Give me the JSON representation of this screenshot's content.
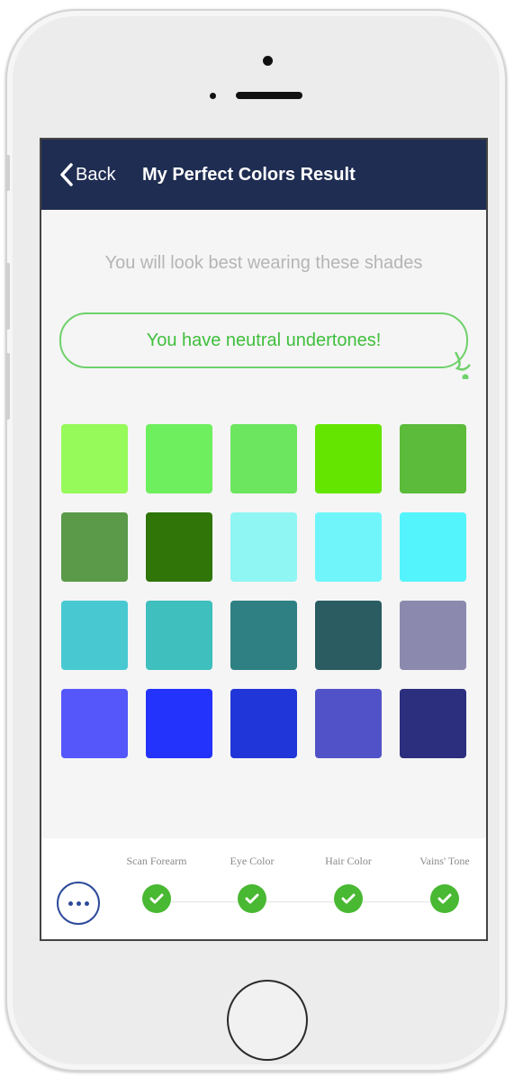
{
  "navbar": {
    "back_label": "Back",
    "title": "My Perfect Colors Result"
  },
  "main": {
    "subtitle": "You will look best wearing these shades",
    "undertone_message": "You have neutral undertones!"
  },
  "swatches": [
    [
      "#96fa5a",
      "#6eef5e",
      "#6ce65f",
      "#64e500",
      "#5cbb3a"
    ],
    [
      "#5a9a48",
      "#2f7508",
      "#8ff6f4",
      "#70f6fa",
      "#54f4fc"
    ],
    [
      "#48c9d2",
      "#3fbfbd",
      "#2f8082",
      "#2a5c62",
      "#8b89ae"
    ],
    [
      "#5557fb",
      "#2433fb",
      "#2136d8",
      "#5252c8",
      "#2c2f7e"
    ]
  ],
  "colors": {
    "navbar_bg": "#1f2d52",
    "accent_green": "#3fbf3c",
    "check_green": "#49b832",
    "more_blue": "#2d4a9a"
  },
  "progress": {
    "more_icon": "ellipsis-icon",
    "steps": [
      {
        "label": "Scan Forearm",
        "done": true,
        "icon": "check-icon"
      },
      {
        "label": "Eye Color",
        "done": true,
        "icon": "check-icon"
      },
      {
        "label": "Hair Color",
        "done": true,
        "icon": "check-icon"
      },
      {
        "label": "Vains' Tone",
        "done": true,
        "icon": "check-icon"
      }
    ]
  }
}
